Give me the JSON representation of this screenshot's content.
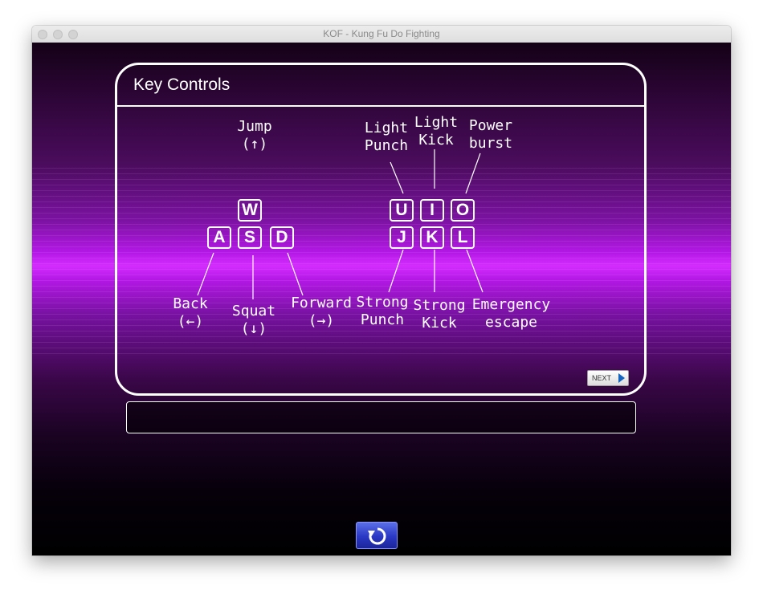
{
  "window": {
    "title": "KOF - Kung Fu Do Fighting"
  },
  "panel": {
    "title": "Key Controls"
  },
  "keys": {
    "w": "W",
    "a": "A",
    "s": "S",
    "d": "D",
    "u": "U",
    "i": "I",
    "o": "O",
    "j": "J",
    "k": "K",
    "l": "L"
  },
  "labels": {
    "jump": "Jump\n(↑)",
    "back": "Back\n(←)",
    "squat": "Squat\n(↓)",
    "forward": "Forward\n(→)",
    "light_punch": "Light\nPunch",
    "light_kick": "Light\nKick",
    "power_burst": "Power\nburst",
    "strong_punch": "Strong\nPunch",
    "strong_kick": "Strong\nKick",
    "emergency_escape": "Emergency\nescape"
  },
  "buttons": {
    "next_label": "NEXT"
  },
  "icons": {
    "next": "arrow-right-icon",
    "restart": "restart-icon"
  },
  "colors": {
    "accent_purple": "#d42cff",
    "restart_blue": "#2a38c4"
  }
}
